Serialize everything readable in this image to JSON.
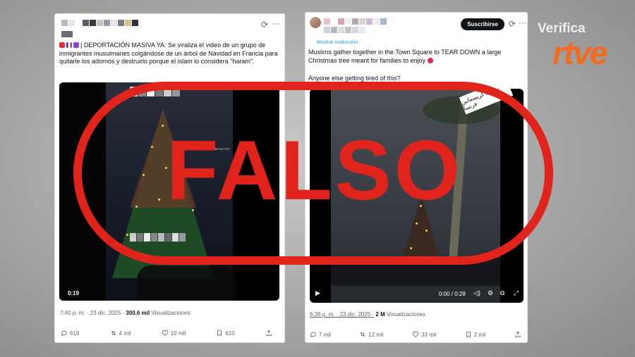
{
  "left_post": {
    "post_text": "| DEPORTACIÓN MASIVA YA: Se viraliza el video de un grupo de inmigrantes musulmanes colgándose de un árbol de Navidad en Francia para quitarle los adornos y destruirlo porque el islam lo considera \"haram\".",
    "video_duration": "0:19",
    "video_watermark": "@INTI.MAJIDBETACTOP",
    "date": "7:40 p. m. · 23 dic. 2025 ·",
    "views_count": "300,6 mil",
    "views_label": "Visualizaciones",
    "actions": {
      "replies": "619",
      "reposts": "4 mil",
      "likes": "10 mil",
      "bookmarks": "610"
    }
  },
  "right_post": {
    "subscribe_label": "Suscribirse",
    "post_text": "Muslims gather together in the Town Square to TEAR DOWN a large Christmas tree meant for families to enjoy",
    "post_text_2": "Anyone else getting tired of this?",
    "translate_link": "Mostrar traducción",
    "video_time": "0:00 / 0:28",
    "arabic_caption": "شجرة كريسماس فرنسا",
    "date": "6:36 p. m. · 23 dic. 2025 ·",
    "views_count": "2 M",
    "views_label": "Visualizaciones",
    "actions": {
      "replies": "7 mil",
      "reposts": "12 mil",
      "likes": "33 mil",
      "bookmarks": "2 mil"
    }
  },
  "stamp": {
    "text": "FALSO",
    "color": "#e0231b"
  },
  "brand": {
    "name_top": "Verifica",
    "name_bottom": "rtve",
    "accent": "#f26b21"
  },
  "icons": [
    "grok-icon",
    "more-icon",
    "reply-icon",
    "repost-icon",
    "like-icon",
    "bookmark-icon",
    "share-icon",
    "play-icon",
    "volume-icon",
    "settings-icon",
    "pip-icon",
    "fullscreen-icon"
  ]
}
